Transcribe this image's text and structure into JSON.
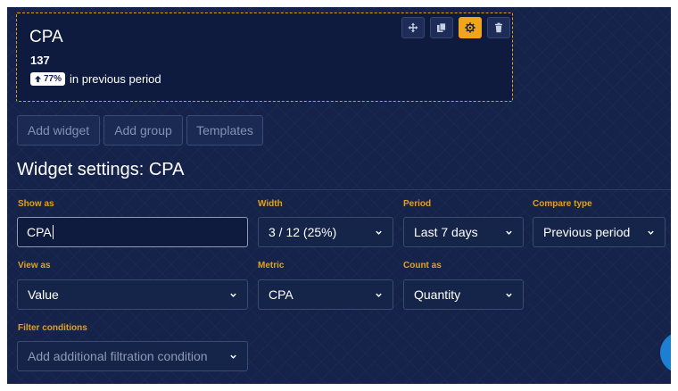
{
  "widget": {
    "title": "CPA",
    "value": "137",
    "change_badge": "77%",
    "change_direction": "up",
    "compare_text": "in previous period",
    "tools": [
      "move-icon",
      "copy-icon",
      "gear-icon",
      "trash-icon"
    ]
  },
  "actions": {
    "add_widget": "Add widget",
    "add_group": "Add group",
    "templates": "Templates"
  },
  "settings": {
    "title": "Widget settings: CPA",
    "show_as": {
      "label": "Show as",
      "value": "CPA"
    },
    "width": {
      "label": "Width",
      "value": "3 / 12 (25%)"
    },
    "period": {
      "label": "Period",
      "value": "Last 7 days"
    },
    "compare_type": {
      "label": "Compare type",
      "value": "Previous period"
    },
    "view_as": {
      "label": "View as",
      "value": "Value"
    },
    "metric": {
      "label": "Metric",
      "value": "CPA"
    },
    "count_as": {
      "label": "Count as",
      "value": "Quantity"
    },
    "filter_conditions": {
      "label": "Filter conditions",
      "placeholder": "Add additional filtration condition"
    }
  },
  "colors": {
    "background": "#15234a",
    "accent": "#f0a61a",
    "label": "#e3a11a",
    "fab": "#1d7fd1"
  }
}
